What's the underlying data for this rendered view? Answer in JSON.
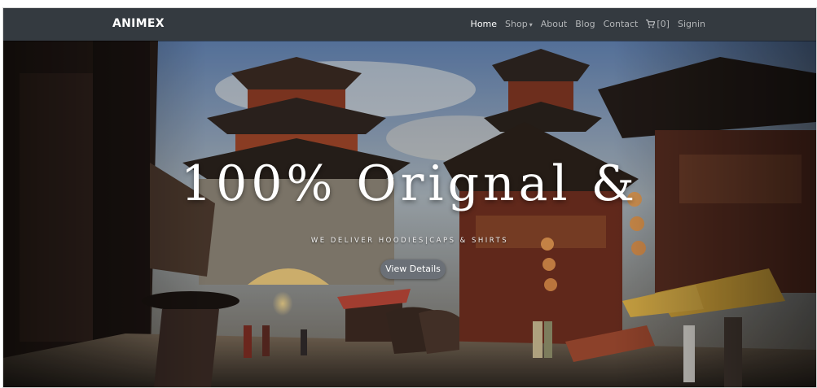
{
  "navbar": {
    "brand": "ANIMEX",
    "items": [
      {
        "label": "Home",
        "active": true
      },
      {
        "label": "Shop",
        "dropdown": true
      },
      {
        "label": "About"
      },
      {
        "label": "Blog"
      },
      {
        "label": "Contact"
      }
    ],
    "cart_count": "[0]",
    "signin": "Signin"
  },
  "hero": {
    "headline": "100% Orignal &",
    "tagline": "WE DELIVER HOODIES|CAPS & SHIRTS",
    "button_label": "View Details"
  },
  "colors": {
    "navbar_bg": "#343a40",
    "button_bg": "#6b7077"
  },
  "icons": [
    "cart-icon",
    "dropdown-caret-icon"
  ]
}
